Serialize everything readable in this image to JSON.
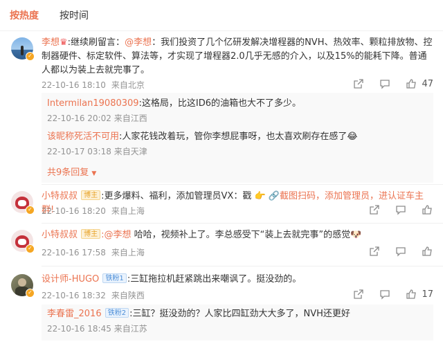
{
  "tabs": {
    "hot": "按热度",
    "time": "按时间"
  },
  "comments": [
    {
      "name": "李想",
      "body": ":继续刷留言：",
      "mention": "@李想",
      "content": "：我们投资了几个亿研发解决增程器的NVH、热效率、颗粒排放物、控制器硬件、标定软件、算法等，才实现了增程器2.0几乎无感的介入，以及15%的能耗下降。普通人都以为装上去就完事了。",
      "date": "22-10-16 18:10",
      "location": "来自北京",
      "likes": "47",
      "replies": [
        {
          "name": "Intermilan19080309",
          "content": ":这格局，比这ID6的油箱也大不了多少。",
          "date": "22-10-16 20:02",
          "location": "来自江西"
        },
        {
          "name": "该昵称死活不可用",
          "content": ":人家花钱改着玩，管你李想屁事呀，也太喜欢刷存在感了",
          "date": "22-10-17 03:18",
          "location": "来自天津"
        }
      ],
      "more": "共9条回复"
    },
    {
      "name": "小特叔叔",
      "badge": "博主",
      "content": ":更多爆料、福利，添加管理员VX：戳",
      "link": "截图扫码，添加管理员，进认证车主群!",
      "date": "22-10-16 18:20",
      "location": "来自上海"
    },
    {
      "name": "小特叔叔",
      "badge": "博主",
      "mention": ":@李想",
      "content": " 哈哈，视频补上了。李总感受下“装上去就完事”的感觉",
      "date": "22-10-16 17:58",
      "location": "来自上海"
    },
    {
      "name": "设计师-HUGO",
      "badge": "铁粉1",
      "content": ":三缸拖拉机赶紧跳出来嘲讽了。挺没劲的。",
      "date": "22-10-16 18:32",
      "location": "来自陕西",
      "likes": "17",
      "replies": [
        {
          "name": "李春雷_2016",
          "badge": "铁粉2",
          "content": ":三缸？挺没劲的？人家比四缸劲大大多了，NVH还更好",
          "date": "22-10-16 18:45",
          "location": "来自江苏"
        }
      ]
    }
  ],
  "colors": {
    "accent": "#eb7350",
    "meta": "#939393",
    "reply_bg": "#f9f9f9"
  },
  "icons": [
    "share-icon",
    "comment-icon",
    "like-icon"
  ]
}
